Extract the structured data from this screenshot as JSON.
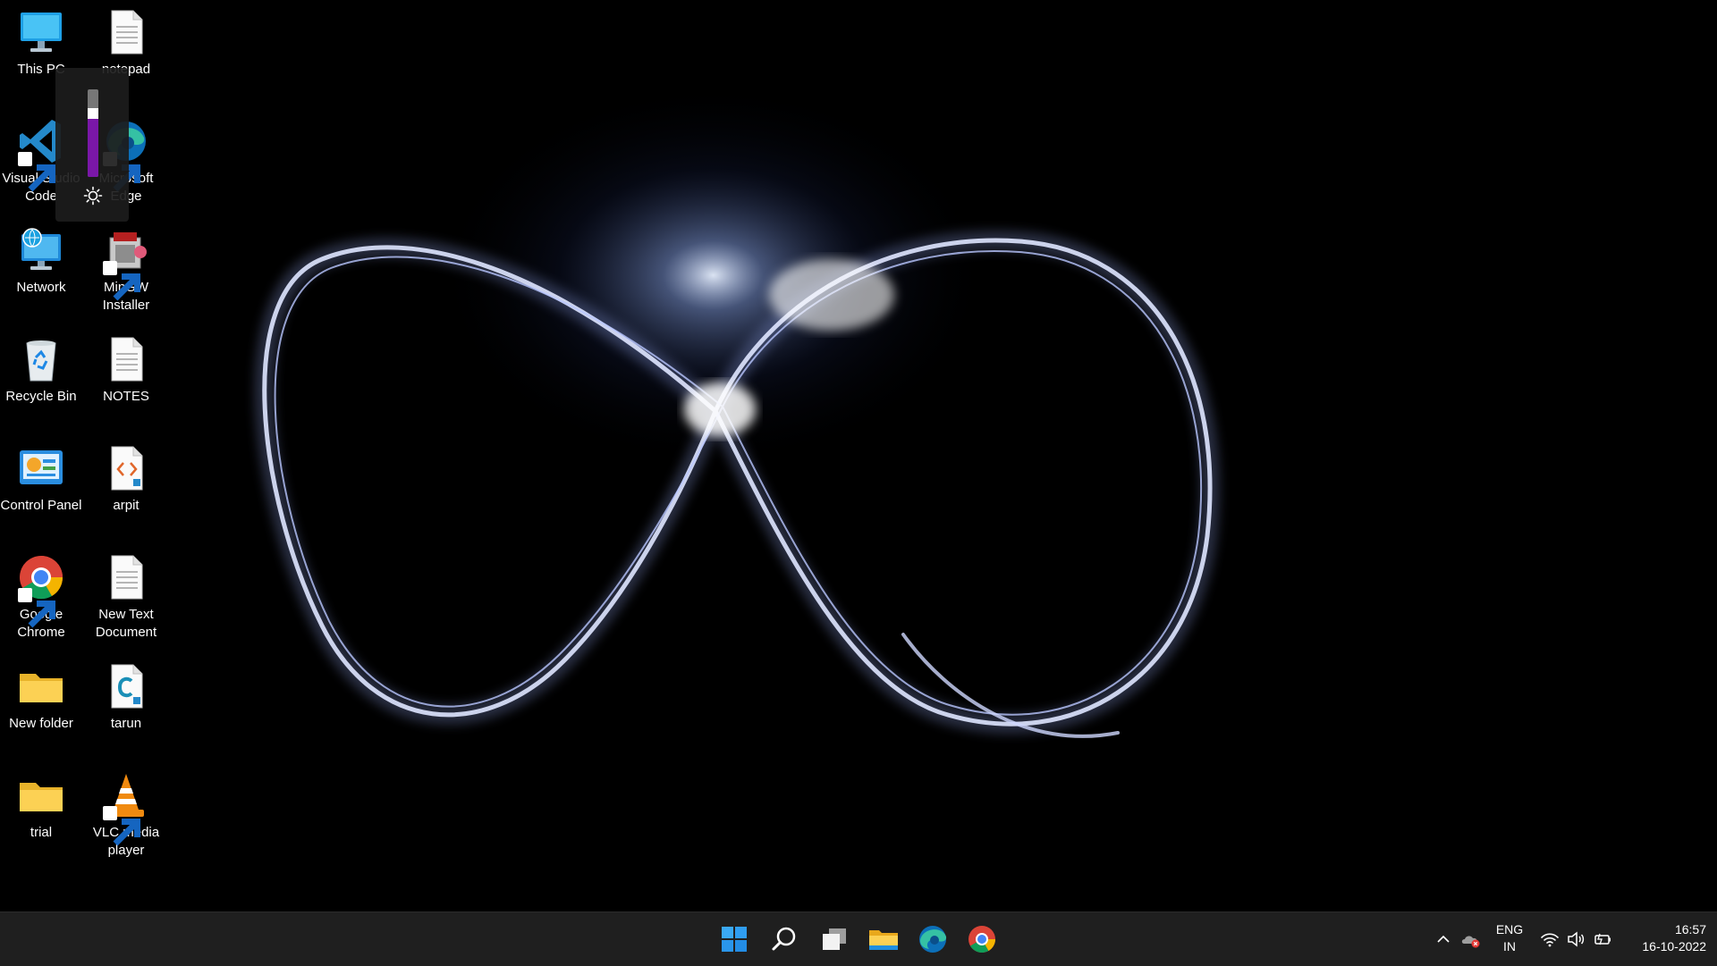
{
  "desktop": {
    "icons": [
      {
        "label": "This PC",
        "icon": "monitor-icon"
      },
      {
        "label": "notepad",
        "icon": "text-file-icon"
      },
      {
        "label": "Visual Studio Code",
        "icon": "vscode-icon",
        "shortcut": true
      },
      {
        "label": "Microsoft Edge",
        "icon": "edge-icon",
        "shortcut": true
      },
      {
        "label": "Network",
        "icon": "network-icon"
      },
      {
        "label": "MinGW Installer",
        "icon": "mingw-installer-icon",
        "shortcut": true
      },
      {
        "label": "Recycle Bin",
        "icon": "recycle-bin-icon"
      },
      {
        "label": "NOTES",
        "icon": "text-file-icon"
      },
      {
        "label": "Control Panel",
        "icon": "control-panel-icon"
      },
      {
        "label": "arpit",
        "icon": "code-file-icon"
      },
      {
        "label": "Google Chrome",
        "icon": "chrome-icon",
        "shortcut": true
      },
      {
        "label": "New Text Document",
        "icon": "text-file-icon"
      },
      {
        "label": "New folder",
        "icon": "folder-icon"
      },
      {
        "label": "tarun",
        "icon": "c-file-icon"
      },
      {
        "label": "trial",
        "icon": "folder-icon"
      },
      {
        "label": "VLC media player",
        "icon": "vlc-icon",
        "shortcut": true
      }
    ]
  },
  "brightness_flyout": {
    "level": 0.72,
    "icon": "brightness-sun-icon",
    "accent_color": "#7a17a8"
  },
  "taskbar": {
    "buttons": [
      {
        "name": "start-button",
        "icon": "windows-logo-icon"
      },
      {
        "name": "search-button",
        "icon": "search-icon"
      },
      {
        "name": "task-view-button",
        "icon": "task-view-icon"
      },
      {
        "name": "file-explorer-button",
        "icon": "file-explorer-icon"
      },
      {
        "name": "edge-taskbar-button",
        "icon": "edge-icon"
      },
      {
        "name": "chrome-taskbar-button",
        "icon": "chrome-icon"
      }
    ],
    "tray": {
      "language_primary": "ENG",
      "language_secondary": "IN",
      "time": "16:57",
      "date": "16-10-2022",
      "icons": [
        "chevron-up-icon",
        "onedrive-error-icon",
        "wifi-icon",
        "speaker-icon",
        "battery-icon"
      ]
    }
  }
}
